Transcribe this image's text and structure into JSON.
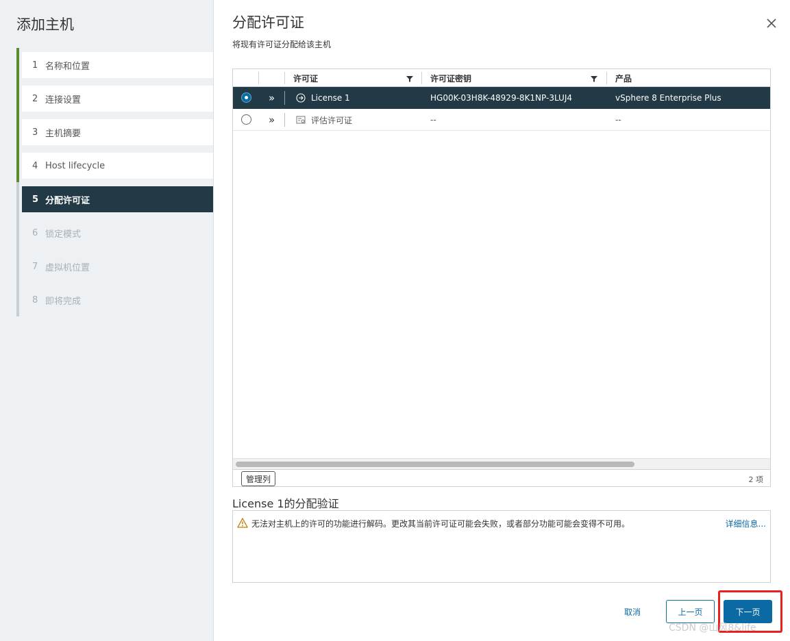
{
  "wizard": {
    "title": "添加主机",
    "steps": [
      {
        "num": "1",
        "label": "名称和位置",
        "state": "done"
      },
      {
        "num": "2",
        "label": "连接设置",
        "state": "done"
      },
      {
        "num": "3",
        "label": "主机摘要",
        "state": "done"
      },
      {
        "num": "4",
        "label": "Host lifecycle",
        "state": "done"
      },
      {
        "num": "5",
        "label": "分配许可证",
        "state": "active"
      },
      {
        "num": "6",
        "label": "锁定模式",
        "state": "todo"
      },
      {
        "num": "7",
        "label": "虚拟机位置",
        "state": "todo"
      },
      {
        "num": "8",
        "label": "即将完成",
        "state": "todo"
      }
    ]
  },
  "main": {
    "title": "分配许可证",
    "subtitle": "将现有许可证分配给该主机"
  },
  "grid": {
    "columns": [
      "许可证",
      "许可证密钥",
      "产品"
    ],
    "rows": [
      {
        "selected": true,
        "icon": "license-icon",
        "license": "License 1",
        "key": "HG00K-03H8K-48929-8K1NP-3LUJ4",
        "product": "vSphere 8 Enterprise Plus"
      },
      {
        "selected": false,
        "icon": "evaluation-license-icon",
        "license": "评估许可证",
        "key": "--",
        "product": "--"
      }
    ],
    "manage_columns_label": "管理列",
    "item_count": "2 项"
  },
  "validation": {
    "title": "License 1的分配验证",
    "warning_text": "无法对主机上的许可的功能进行解码。更改其当前许可证可能会失败，或者部分功能可能会变得不可用。",
    "details_link": "详细信息..."
  },
  "footer": {
    "cancel": "取消",
    "back": "上一页",
    "next": "下一页"
  },
  "watermark": "CSDN @山风8&life",
  "colors": {
    "accent": "#0b6aa3",
    "nav_active": "#223a46",
    "step_done": "#5b8c2a",
    "highlight": "#e82020"
  }
}
